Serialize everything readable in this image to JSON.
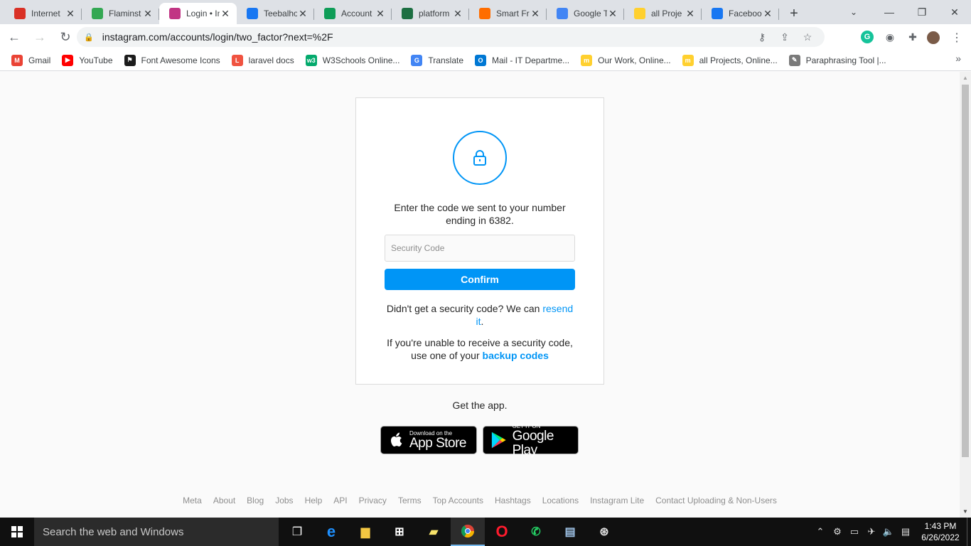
{
  "browser": {
    "tabs": [
      {
        "title": "Internet",
        "icon": "speedometer-icon",
        "color": "#d93025"
      },
      {
        "title": "Flaminst",
        "icon": "circle-icon",
        "color": "#34a853"
      },
      {
        "title": "Login • Instagram",
        "icon": "instagram-icon",
        "color": "#c13584",
        "active": true
      },
      {
        "title": "Teebalhoo",
        "icon": "facebook-icon",
        "color": "#1877f2"
      },
      {
        "title": "Account",
        "icon": "sheets-plus-icon",
        "color": "#0f9d58"
      },
      {
        "title": "platform",
        "icon": "excel-icon",
        "color": "#1d6f42"
      },
      {
        "title": "Smart Fr",
        "icon": "smart-icon",
        "color": "#ff6d00"
      },
      {
        "title": "Google T",
        "icon": "translate-icon",
        "color": "#4285f4"
      },
      {
        "title": "all Proje",
        "icon": "miro-icon",
        "color": "#ffd02f"
      },
      {
        "title": "Faceboo",
        "icon": "facebook-icon",
        "color": "#1877f2"
      }
    ],
    "url": "instagram.com/accounts/login/two_factor?next=%2F",
    "bookmarks": [
      {
        "label": "Gmail",
        "color": "#ea4335",
        "glyph": "M"
      },
      {
        "label": "YouTube",
        "color": "#ff0000",
        "glyph": "▶"
      },
      {
        "label": "Font Awesome Icons",
        "color": "#1c1c1c",
        "glyph": "⚑"
      },
      {
        "label": "laravel docs",
        "color": "#f05340",
        "glyph": "L"
      },
      {
        "label": "W3Schools Online...",
        "color": "#04aa6d",
        "glyph": "w3"
      },
      {
        "label": "Translate",
        "color": "#4285f4",
        "glyph": "G"
      },
      {
        "label": "Mail - IT Departme...",
        "color": "#0078d4",
        "glyph": "O"
      },
      {
        "label": "Our Work, Online...",
        "color": "#ffd02f",
        "glyph": "m"
      },
      {
        "label": "all Projects, Online...",
        "color": "#ffd02f",
        "glyph": "m"
      },
      {
        "label": "Paraphrasing Tool |...",
        "color": "#7a7a7a",
        "glyph": "✎"
      }
    ]
  },
  "page": {
    "message": "Enter the code we sent to your number ending in 6382.",
    "code_placeholder": "Security Code",
    "confirm_label": "Confirm",
    "resend_text": "Didn't get a security code? We can",
    "resend_link": "resend it",
    "resend_suffix": ".",
    "backup_text": "If you're unable to receive a security code, use one of your",
    "backup_link": "backup codes",
    "get_app": "Get the app.",
    "app_store_small": "Download on the",
    "app_store_large": "App Store",
    "google_play_small": "GET IT ON",
    "google_play_large": "Google Play",
    "footer_links": [
      "Meta",
      "About",
      "Blog",
      "Jobs",
      "Help",
      "API",
      "Privacy",
      "Terms",
      "Top Accounts",
      "Hashtags",
      "Locations",
      "Instagram Lite",
      "Contact Uploading & Non-Users"
    ],
    "accent": "#0095f6"
  },
  "taskbar": {
    "search_placeholder": "Search the web and Windows",
    "time": "1:43 PM",
    "date": "6/26/2022"
  }
}
